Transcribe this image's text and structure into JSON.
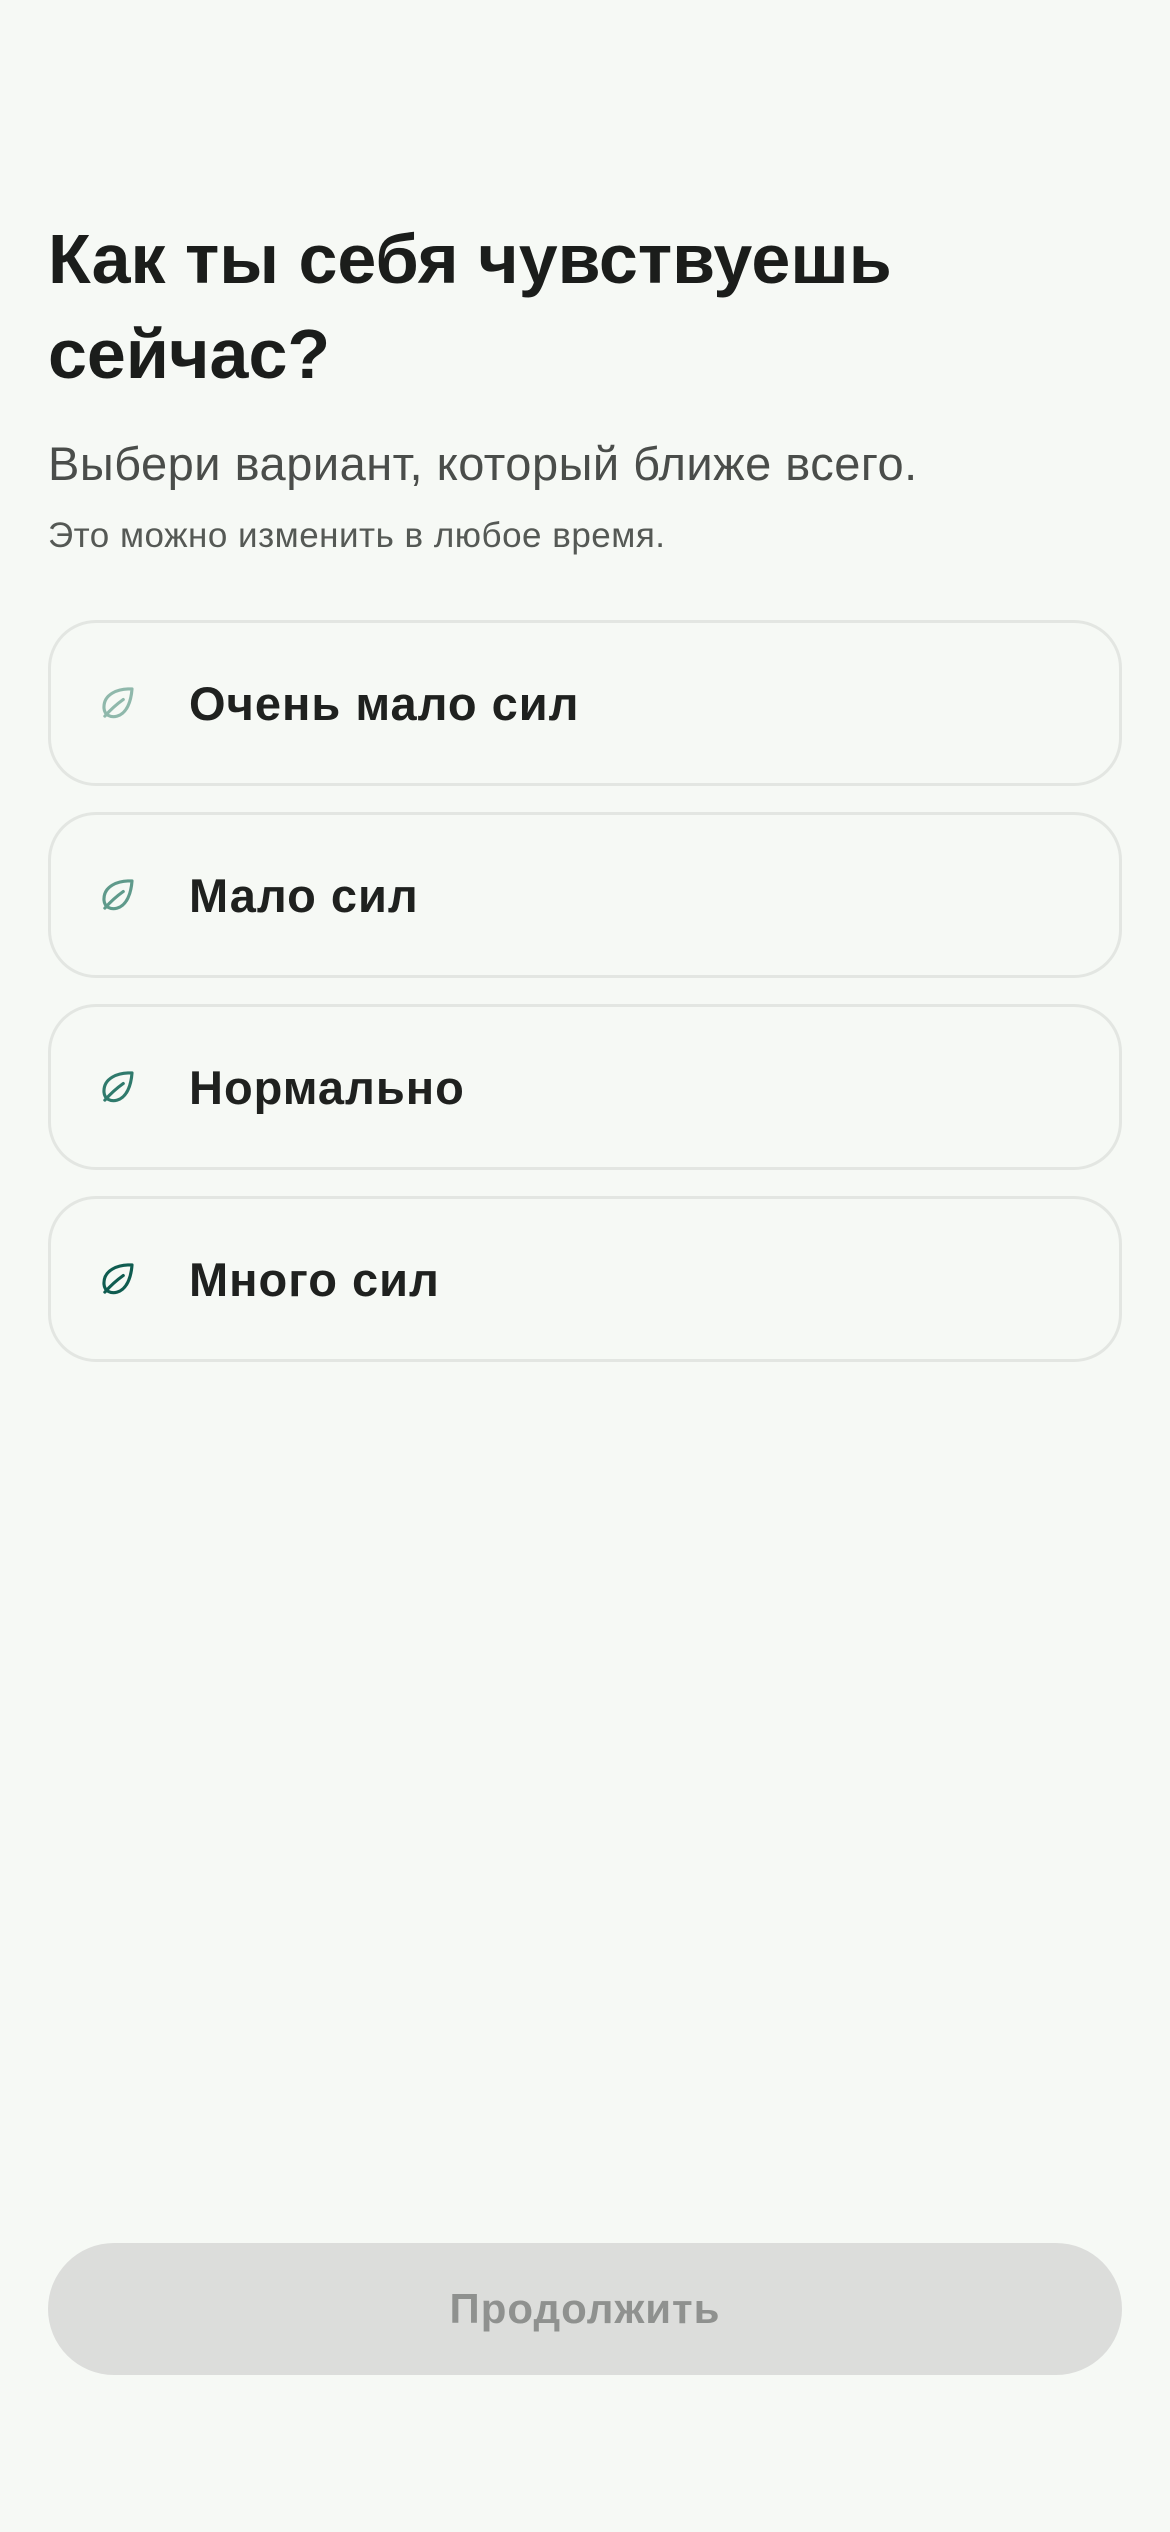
{
  "question": {
    "title": "Как ты себя чувствуешь сейчас?",
    "subtitle": "Выбери вариант, который ближе всего.",
    "hint": "Это можно изменить в любое время."
  },
  "options": [
    {
      "label": "Очень мало сил",
      "icon": "leaf-icon",
      "icon_color": "#8fb8ab"
    },
    {
      "label": "Мало сил",
      "icon": "leaf-icon",
      "icon_color": "#5f9a8b"
    },
    {
      "label": "Нормально",
      "icon": "leaf-icon",
      "icon_color": "#2f7a6c"
    },
    {
      "label": "Много сил",
      "icon": "leaf-icon",
      "icon_color": "#0f5c50"
    }
  ],
  "footer": {
    "continue_label": "Продолжить",
    "continue_disabled": true
  },
  "colors": {
    "background": "#f6f9f5",
    "text_primary": "#1b1d1b",
    "option_border": "#e3e6e2",
    "button_disabled_bg": "#dcdddb",
    "button_disabled_text": "#8f918f"
  }
}
